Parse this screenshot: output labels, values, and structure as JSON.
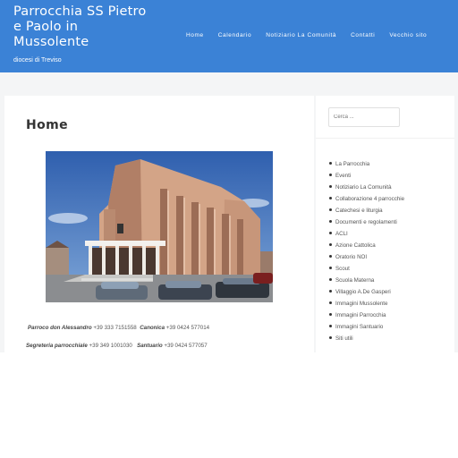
{
  "site": {
    "title": "Parrocchia SS Pietro e Paolo in Mussolente",
    "description": "diocesi di Treviso"
  },
  "nav": {
    "items": [
      {
        "label": "Home"
      },
      {
        "label": "Calendario"
      },
      {
        "label": "Notiziario La Comunità"
      },
      {
        "label": "Contatti"
      },
      {
        "label": "Vecchio sito"
      }
    ]
  },
  "main": {
    "page_title": "Home",
    "contacts": {
      "row1": [
        {
          "role": "Parroco don Alessandro",
          "phone": "+39 333 7151558"
        },
        {
          "role": "Canonica",
          "phone": "+39 0424 577014"
        }
      ],
      "row2": [
        {
          "role": "Segreteria parrocchiale",
          "phone": "+39 349 1001030"
        },
        {
          "role": "Santuario",
          "phone": "+39 0424 577057"
        }
      ]
    }
  },
  "sidebar": {
    "search_placeholder": "Cerca ...",
    "links": [
      {
        "label": "La Parrocchia"
      },
      {
        "label": "Eventi"
      },
      {
        "label": "Notiziario La Comunità"
      },
      {
        "label": "Collaborazione 4 parrocchie"
      },
      {
        "label": "Catechesi e liturgia"
      },
      {
        "label": "Documenti e regolamenti"
      },
      {
        "label": "ACLI"
      },
      {
        "label": "Azione Cattolica"
      },
      {
        "label": "Oratorio NOI"
      },
      {
        "label": "Scout"
      },
      {
        "label": "Scuola Materna"
      },
      {
        "label": "Villaggio A.De Gasperi"
      },
      {
        "label": "Immagini Mussolente"
      },
      {
        "label": "Immagini Parrocchia"
      },
      {
        "label": "Immagini Santuario"
      },
      {
        "label": "Siti utili"
      }
    ]
  },
  "colors": {
    "header_bg": "#3b82d6",
    "band_bg": "#f4f5f6"
  },
  "icons": {
    "photo": "church-photo"
  }
}
